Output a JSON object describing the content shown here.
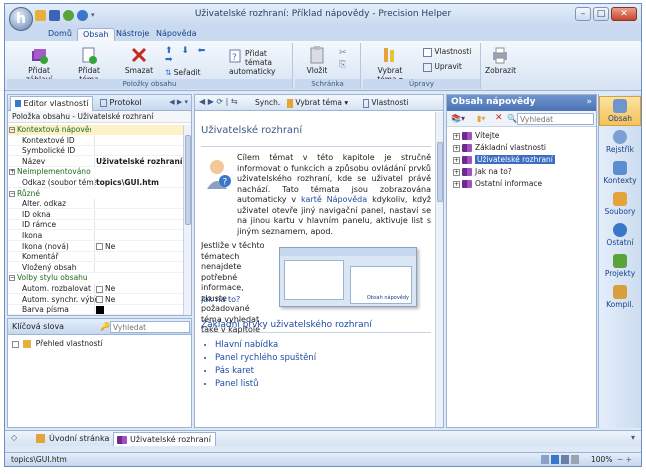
{
  "window": {
    "title": "Uživatelské rozhraní: Příklad nápovědy - Precision Helper"
  },
  "app_orb_letter": "h",
  "ribbon_tabs": [
    "Domů",
    "Obsah",
    "Nástroje",
    "Nápověda"
  ],
  "ribbon": {
    "add_header": "Přidat záhlaví",
    "add_topic": "Přidat téma",
    "delete": "Smazat",
    "sort": "Seřadit",
    "add_auto_topics": "Přidat témata automaticky",
    "group_items": "Položky obsahu",
    "paste": "Vložit",
    "group_clipboard": "Schránka",
    "select_topic": "Vybrat téma",
    "properties": "Vlastnosti",
    "edit": "Upravit",
    "group_edits": "Úpravy",
    "show": "Zobrazit"
  },
  "left_panel": {
    "tab_editor": "Editor vlastností",
    "tab_protocol": "Protokol",
    "header": "Položka obsahu - Uživatelské rozhraní",
    "rows": [
      {
        "label": "Kontextová nápověda",
        "value": "",
        "group": true,
        "exp": "−"
      },
      {
        "label": "Kontextové ID",
        "value": "",
        "group": false
      },
      {
        "label": "Symbolické ID",
        "value": "",
        "group": false
      },
      {
        "label": "Název",
        "value": "Uživatelské rozhraní",
        "group": false,
        "bold": true
      },
      {
        "label": "Neimplementováno",
        "value": "",
        "group": true,
        "exp": "+"
      },
      {
        "label": "Odkaz (soubor téma)",
        "value": "topics\\GUI.htm",
        "group": false,
        "bold": true
      },
      {
        "label": "Různé",
        "value": "",
        "group": true,
        "exp": "−"
      },
      {
        "label": "Alter. odkaz",
        "value": "",
        "group": false
      },
      {
        "label": "ID okna",
        "value": "",
        "group": false
      },
      {
        "label": "ID rámce",
        "value": "",
        "group": false
      },
      {
        "label": "Ikona",
        "value": "",
        "group": false
      },
      {
        "label": "Ikona (nová)",
        "value": "Ne",
        "group": false
      },
      {
        "label": "Komentář",
        "value": "",
        "group": false
      },
      {
        "label": "Vložený obsah",
        "value": "",
        "group": false
      },
      {
        "label": "Volby stylu obsahu",
        "value": "",
        "group": true,
        "exp": "−"
      },
      {
        "label": "Autom. rozbalovat",
        "value": "Ne",
        "group": false
      },
      {
        "label": "Autom. synchr. výběr",
        "value": "Ne",
        "group": false
      },
      {
        "label": "Barva písma",
        "value": "",
        "group": false
      }
    ],
    "keywords_label": "Klíčová slova",
    "search_placeholder": "Vyhledat",
    "overview_label": "Přehled vlastností"
  },
  "center": {
    "toolbar_sync": "Synch.",
    "toolbar_select": "Vybrat téma",
    "toolbar_props": "Vlastnosti",
    "page_title": "Uživatelské rozhraní",
    "para1": "Cílem témat v této kapitole je stručně informovat o funkcích a způsobu ovládání prvků uživatelského rozhraní, kde se uživatel právě nachází. Tato témata jsou zobrazována automaticky v",
    "link_karta": "kartě Nápověda",
    "para1b": "kdykoliv, když uživatel otevře jiný navigační panel, nastaví se na jinou kartu v hlavním panelu, aktivuje list s jiným seznamem, apod.",
    "para2": "Jestliže v těchto tématech nenajdete potřebné informace, zkuste požadované téma vyhledat také v kapitole",
    "link_jak": "Jak na to?",
    "thumb_caption": "Obsah nápovědy",
    "section_title": "Základní prvky uživatelského rozhraní",
    "bullets": [
      "Hlavní nabídka",
      "Panel rychlého spuštění",
      "Pás karet",
      "Panel listů"
    ]
  },
  "help_panel": {
    "title": "Obsah nápovědy",
    "search_placeholder": "Vyhledat",
    "items": [
      "Vítejte",
      "Základní vlastnosti",
      "Uživatelské rozhraní",
      "Jak na to?",
      "Ostatní informace"
    ]
  },
  "right_nav": [
    "Obsah",
    "Rejstřík",
    "Kontexty",
    "Soubory",
    "Ostatní",
    "Projekty",
    "Kompil."
  ],
  "doc_tabs": {
    "start": "Úvodní stránka",
    "current": "Uživatelské rozhraní"
  },
  "status": {
    "path": "topics\\GUI.htm",
    "zoom": "100%"
  }
}
